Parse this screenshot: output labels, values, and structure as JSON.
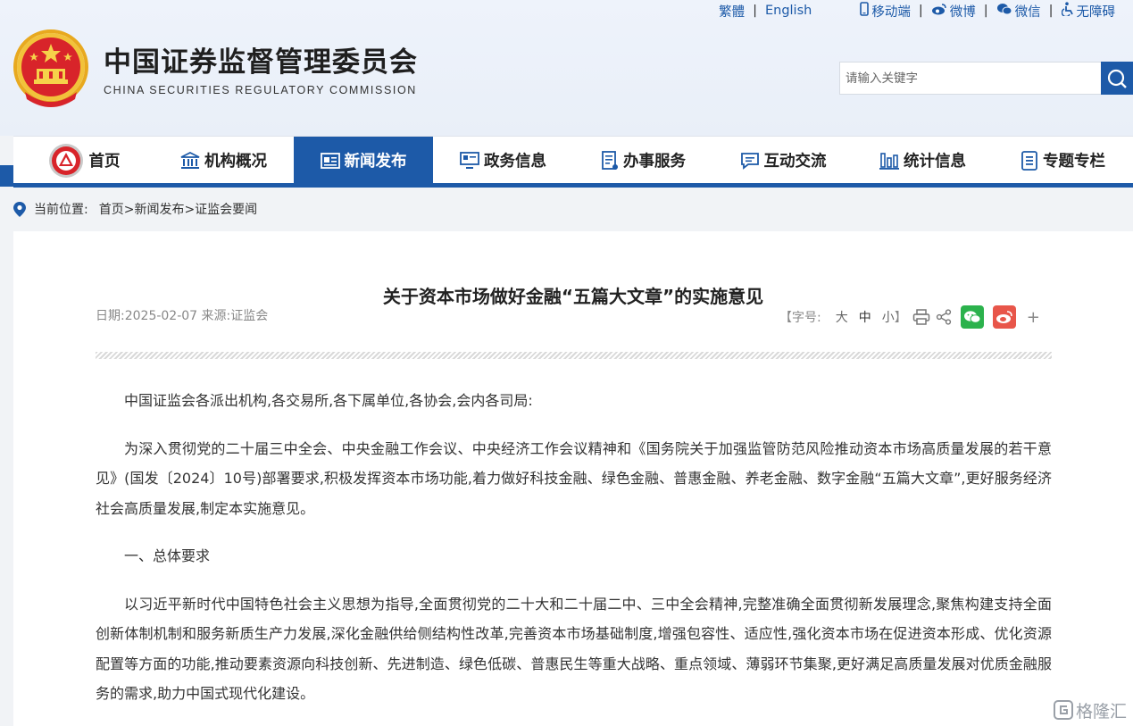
{
  "header": {
    "title_cn": "中国证券监督管理委员会",
    "title_en": "CHINA SECURITIES REGULATORY COMMISSION",
    "top_links": {
      "traditional": "繁體",
      "english": "English",
      "mobile": "移动端",
      "weibo": "微博",
      "wechat": "微信",
      "accessibility": "无障碍"
    },
    "search": {
      "placeholder": "请输入关键字",
      "value": ""
    }
  },
  "nav": {
    "items": [
      {
        "label": "首页",
        "icon": "emblem-icon"
      },
      {
        "label": "机构概况",
        "icon": "building-icon"
      },
      {
        "label": "新闻发布",
        "icon": "news-icon",
        "active": true
      },
      {
        "label": "政务信息",
        "icon": "monitor-icon"
      },
      {
        "label": "办事服务",
        "icon": "document-icon"
      },
      {
        "label": "互动交流",
        "icon": "chat-icon"
      },
      {
        "label": "统计信息",
        "icon": "bar-chart-icon"
      },
      {
        "label": "专题专栏",
        "icon": "list-icon"
      }
    ]
  },
  "breadcrumb": {
    "label": "当前位置:",
    "path": "首页>新闻发布>证监会要闻"
  },
  "article": {
    "title": "关于资本市场做好金融“五篇大文章”的实施意见",
    "meta": "日期:2025-02-07 来源:证监会",
    "font_size_label": "【字号:",
    "font_sizes": [
      "大",
      "中",
      "小"
    ],
    "font_size_close": "】",
    "paragraphs": [
      "中国证监会各派出机构,各交易所,各下属单位,各协会,会内各司局:",
      "为深入贯彻党的二十届三中全会、中央金融工作会议、中央经济工作会议精神和《国务院关于加强监管防范风险推动资本市场高质量发展的若干意见》(国发〔2024〕10号)部署要求,积极发挥资本市场功能,着力做好科技金融、绿色金融、普惠金融、养老金融、数字金融“五篇大文章”,更好服务经济社会高质量发展,制定本实施意见。",
      "一、总体要求",
      "以习近平新时代中国特色社会主义思想为指导,全面贯彻党的二十大和二十届二中、三中全会精神,完整准确全面贯彻新发展理念,聚焦构建支持全面创新体制机制和服务新质生产力发展,深化金融供给侧结构性改革,完善资本市场基础制度,增强包容性、适应性,强化资本市场在促进资本形成、优化资源配置等方面的功能,推动要素资源向科技创新、先进制造、绿色低碳、普惠民生等重大战略、重点领域、薄弱环节集聚,更好满足高质量发展对优质金融服务的需求,助力中国式现代化建设。"
    ]
  },
  "watermark": {
    "text": "格隆汇"
  },
  "colors": {
    "brand_blue": "#1d5aa8",
    "wechat_green": "#2bb24c",
    "weibo_red": "#e8564a"
  }
}
